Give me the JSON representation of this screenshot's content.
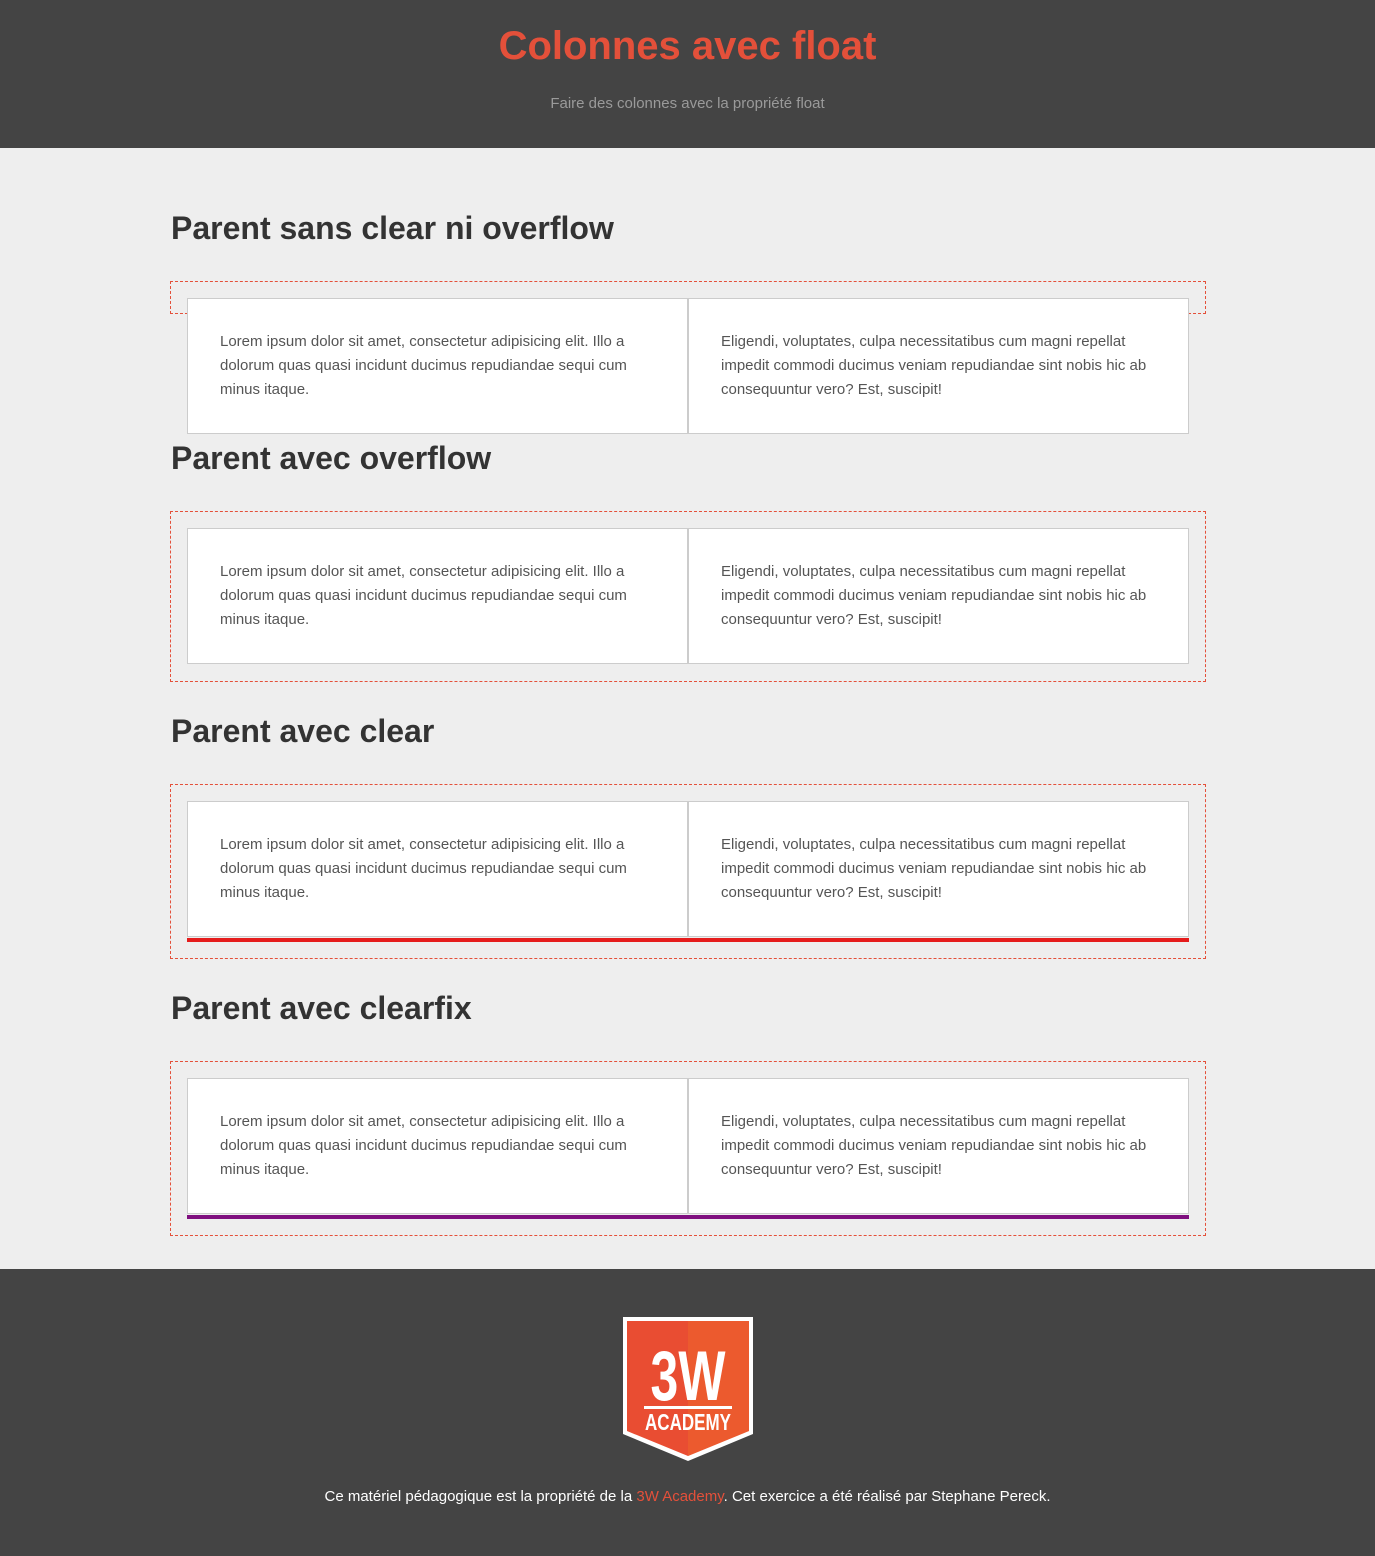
{
  "header": {
    "title": "Colonnes avec float",
    "subtitle": "Faire des colonnes avec la propriété float"
  },
  "sections": [
    {
      "title": "Parent sans clear ni overflow",
      "left_text": "Lorem ipsum dolor sit amet, consectetur adipisicing elit. Illo a dolorum quas quasi incidunt ducimus repudiandae sequi cum minus itaque.",
      "right_text": "Eligendi, voluptates, culpa necessitatibus cum magni repellat impedit commodi ducimus veniam repudiandae sint nobis hic ab consequuntur vero? Est, suscipit!"
    },
    {
      "title": "Parent avec overflow",
      "left_text": "Lorem ipsum dolor sit amet, consectetur adipisicing elit. Illo a dolorum quas quasi incidunt ducimus repudiandae sequi cum minus itaque.",
      "right_text": "Eligendi, voluptates, culpa necessitatibus cum magni repellat impedit commodi ducimus veniam repudiandae sint nobis hic ab consequuntur vero? Est, suscipit!"
    },
    {
      "title": "Parent avec clear",
      "left_text": "Lorem ipsum dolor sit amet, consectetur adipisicing elit. Illo a dolorum quas quasi incidunt ducimus repudiandae sequi cum minus itaque.",
      "right_text": "Eligendi, voluptates, culpa necessitatibus cum magni repellat impedit commodi ducimus veniam repudiandae sint nobis hic ab consequuntur vero? Est, suscipit!",
      "bar_color": "#e51c1c"
    },
    {
      "title": "Parent avec clearfix",
      "left_text": "Lorem ipsum dolor sit amet, consectetur adipisicing elit. Illo a dolorum quas quasi incidunt ducimus repudiandae sequi cum minus itaque.",
      "right_text": "Eligendi, voluptates, culpa necessitatibus cum magni repellat impedit commodi ducimus veniam repudiandae sint nobis hic ab consequuntur vero? Est, suscipit!",
      "bar_color": "#7f0f7f"
    }
  ],
  "footer": {
    "logo": {
      "name": "3w-academy-logo",
      "line1": "3W",
      "line2": "ACADEMY"
    },
    "text_before": "Ce matériel pédagogique est la propriété de la ",
    "link_text": "3W Academy",
    "text_after": ". Cet exercice a été réalisé par Stephane Pereck."
  },
  "colors": {
    "accent": "#e4503a",
    "header_bg": "#444444",
    "page_bg": "#eeeeee"
  }
}
